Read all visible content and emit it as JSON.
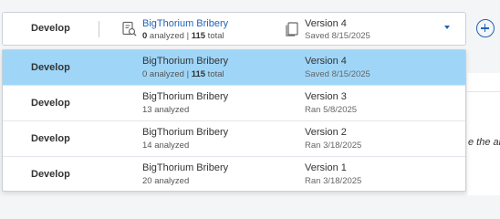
{
  "selector": {
    "stage": "Develop",
    "dataset_name": "BigThorium Bribery",
    "dataset_analyzed": "0",
    "dataset_analyzed_label": " analyzed | ",
    "dataset_total": "115",
    "dataset_total_label": " total",
    "version_name": "Version 4",
    "version_date": "Saved 8/15/2025"
  },
  "background": {
    "partial_text": "e the an"
  },
  "options": [
    {
      "stage": "Develop",
      "dataset_name": "BigThorium Bribery",
      "analyzed": "0",
      "analyzed_label": " analyzed | ",
      "total": "115",
      "total_label": " total",
      "version_name": "Version 4",
      "version_date": "Saved 8/15/2025",
      "selected": true
    },
    {
      "stage": "Develop",
      "dataset_name": "BigThorium Bribery",
      "analyzed_text": "13 analyzed",
      "version_name": "Version 3",
      "version_date": "Ran 5/8/2025",
      "selected": false
    },
    {
      "stage": "Develop",
      "dataset_name": "BigThorium Bribery",
      "analyzed_text": "14 analyzed",
      "version_name": "Version 2",
      "version_date": "Ran 3/18/2025",
      "selected": false
    },
    {
      "stage": "Develop",
      "dataset_name": "BigThorium Bribery",
      "analyzed_text": "20 analyzed",
      "version_name": "Version 1",
      "version_date": "Ran 3/18/2025",
      "selected": false
    }
  ],
  "colors": {
    "accent": "#1f64b8",
    "selected_row": "#9fd6f8",
    "border": "#c9d0d8"
  },
  "icons": {
    "dataset": "dataset-search-icon",
    "version": "version-copies-icon",
    "dropdown": "caret-down-icon",
    "add": "add-circle-icon"
  }
}
